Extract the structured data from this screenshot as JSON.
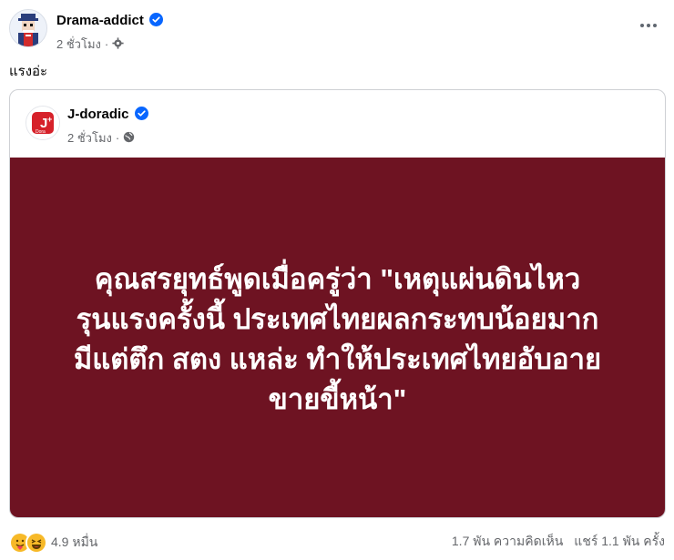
{
  "post": {
    "author": "Drama-addict",
    "time": "2 ชั่วโมง",
    "separator": "·",
    "text": "แรงอ่ะ"
  },
  "shared_post": {
    "author": "J-doradic",
    "time": "2 ชั่วโมง",
    "separator": "·",
    "logo_text": "J",
    "logo_subtext": "Dora",
    "quote": "คุณสรยุทธ์พูดเมื่อครู่ว่า \"เหตุแผ่นดินไหว\nรุนแรงครั้งนี้ ประเทศไทยผลกระทบน้อยมาก\nมีแต่ตึก สตง แหล่ะ ทำให้ประเทศไทยอับอาย\nขายขี้หน้า\"",
    "card_color": "#6e1322"
  },
  "footer": {
    "reaction_count": "4.9 หมื่น",
    "comments": "1.7 พัน ความคิดเห็น",
    "shares": "แชร์ 1.1 พัน ครั้ง"
  },
  "colors": {
    "verified": "#0866ff",
    "muted_text": "#65676b"
  },
  "icons": [
    "verified-badge-icon",
    "settings-gear-icon",
    "public-globe-icon",
    "more-options-icon",
    "reaction-care-icon",
    "reaction-haha-icon"
  ]
}
